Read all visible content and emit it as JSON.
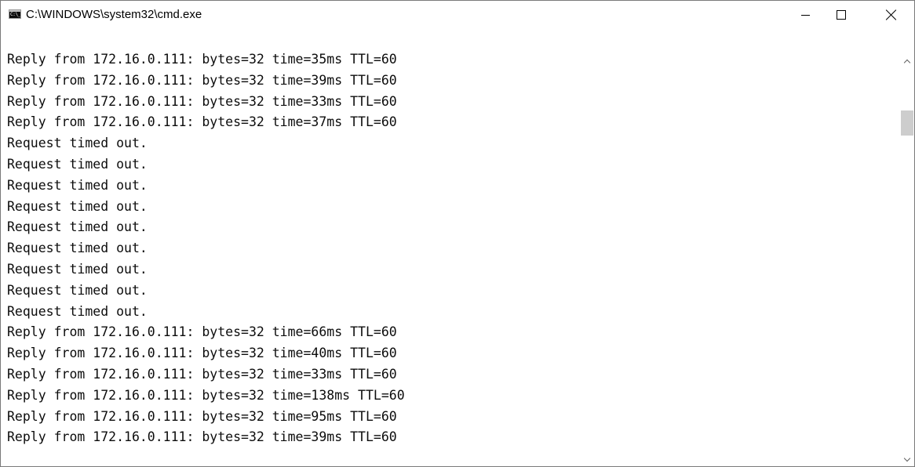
{
  "window": {
    "title": "C:\\WINDOWS\\system32\\cmd.exe",
    "icon_label": "C:\\_",
    "icon": "console-app-icon"
  },
  "caption_buttons": {
    "minimize": "minimize-icon",
    "maximize": "maximize-icon",
    "close": "close-icon"
  },
  "console": {
    "lines": [
      "Reply from 172.16.0.111: bytes=32 time=35ms TTL=60",
      "Reply from 172.16.0.111: bytes=32 time=39ms TTL=60",
      "Reply from 172.16.0.111: bytes=32 time=33ms TTL=60",
      "Reply from 172.16.0.111: bytes=32 time=37ms TTL=60",
      "Request timed out.",
      "Request timed out.",
      "Request timed out.",
      "Request timed out.",
      "Request timed out.",
      "Request timed out.",
      "Request timed out.",
      "Request timed out.",
      "Request timed out.",
      "Reply from 172.16.0.111: bytes=32 time=66ms TTL=60",
      "Reply from 172.16.0.111: bytes=32 time=40ms TTL=60",
      "Reply from 172.16.0.111: bytes=32 time=33ms TTL=60",
      "Reply from 172.16.0.111: bytes=32 time=138ms TTL=60",
      "Reply from 172.16.0.111: bytes=32 time=95ms TTL=60",
      "Reply from 172.16.0.111: bytes=32 time=39ms TTL=60"
    ]
  },
  "colors": {
    "console_background": "#ffffff",
    "console_text": "#0c0c0c",
    "scroll_thumb": "#cdcdcd"
  }
}
